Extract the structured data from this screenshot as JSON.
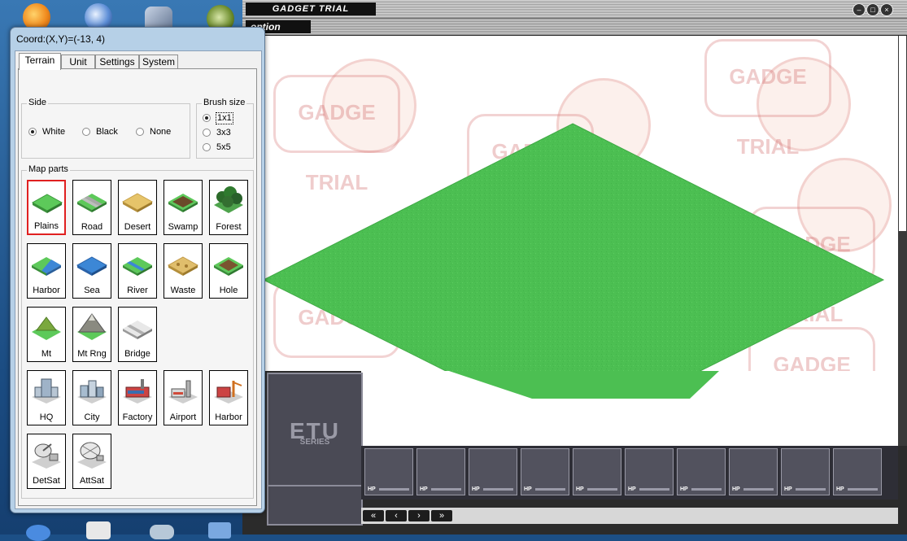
{
  "game": {
    "title": "GADGET TRIAL",
    "menu_label": "option",
    "window_buttons": [
      "–",
      "□",
      "×"
    ],
    "watermark_text": "GADGE TRIAL",
    "logo_text": "ETU",
    "logo_sub": "SERIES",
    "unit_slots": [
      "HP",
      "HP",
      "HP",
      "HP",
      "HP",
      "HP",
      "HP",
      "HP",
      "HP",
      "HP"
    ],
    "nav_buttons": [
      "«",
      "‹",
      "›",
      "»"
    ]
  },
  "editor": {
    "coord_text": "Coord:(X,Y)=(-13,  4)",
    "tabs": [
      "Terrain",
      "Unit",
      "Settings",
      "System"
    ],
    "active_tab": "Terrain",
    "side": {
      "label": "Side",
      "options": [
        "White",
        "Black",
        "None"
      ],
      "selected": "White"
    },
    "brush": {
      "label": "Brush size",
      "options": [
        "1x1",
        "3x3",
        "5x5"
      ],
      "selected": "1x1"
    },
    "map_parts": {
      "label": "Map parts",
      "selected": "Plains",
      "items": [
        "Plains",
        "Road",
        "Desert",
        "Swamp",
        "Forest",
        "Harbor",
        "Sea",
        "River",
        "Waste",
        "Hole",
        "Mt",
        "Mt Rng",
        "Bridge",
        "HQ",
        "City",
        "Factory",
        "Airport",
        "Harbor",
        "DetSat",
        "AttSat"
      ]
    }
  },
  "colors": {
    "grass": "#4cbf52",
    "selected_border": "#e02020",
    "panel_frame": "#b6d0e7"
  }
}
